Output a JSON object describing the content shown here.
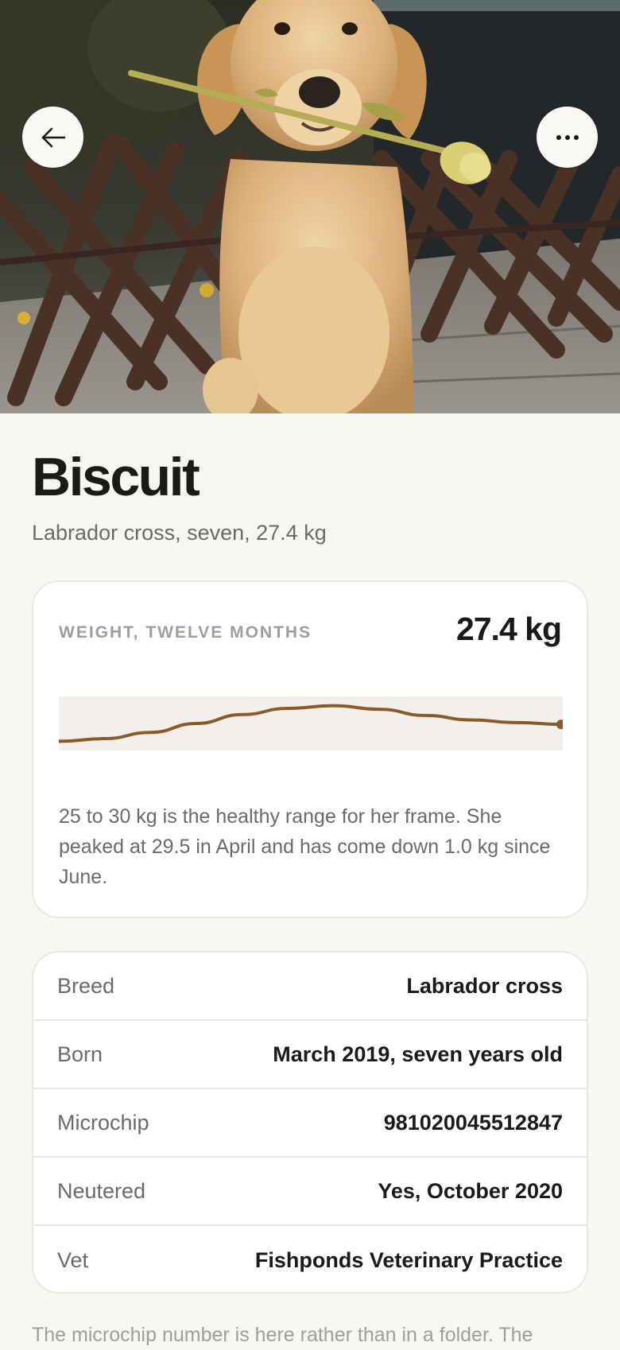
{
  "hero": {
    "photo": "dog-with-tulip-photo"
  },
  "nav": {
    "back_icon": "arrow-left-icon",
    "more_icon": "ellipsis-icon"
  },
  "pet": {
    "name": "Biscuit",
    "summary": "Labrador cross, seven, 27.4 kg"
  },
  "weight_card": {
    "label": "WEIGHT, TWELVE MONTHS",
    "current": "27.4 kg",
    "note": "25 to 30 kg is the healthy range for her frame. She peaked at 29.5 in April and has come down 1.0 kg since June.",
    "line_color": "#8a5a2b",
    "band_color": "#f3f0eb"
  },
  "chart_data": {
    "type": "line",
    "title": "",
    "xlabel": "",
    "ylabel": "",
    "band": [
      25,
      30
    ],
    "ylim": [
      25,
      30
    ],
    "x": [
      1,
      2,
      3,
      4,
      5,
      6,
      7,
      8,
      9,
      10,
      11,
      12
    ],
    "series": [
      {
        "values": [
          25.5,
          25.8,
          26.5,
          27.5,
          28.5,
          29.2,
          29.5,
          29.1,
          28.4,
          27.9,
          27.6,
          27.4
        ]
      }
    ]
  },
  "details": [
    {
      "label": "Breed",
      "value": "Labrador cross"
    },
    {
      "label": "Born",
      "value": "March 2019, seven years old"
    },
    {
      "label": "Microchip",
      "value": "981020045512847"
    },
    {
      "label": "Neutered",
      "value": "Yes, October 2020"
    },
    {
      "label": "Vet",
      "value": "Fishponds Veterinary Practice"
    }
  ],
  "footer": {
    "note": "The microchip number is here rather than in a folder. The"
  }
}
